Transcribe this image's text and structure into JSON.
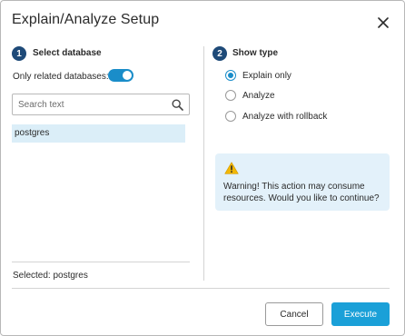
{
  "dialog": {
    "title": "Explain/Analyze Setup",
    "close_icon": "close-icon"
  },
  "step1": {
    "number": "1",
    "title": "Select database",
    "toggle_label": "Only related databases:",
    "toggle_on": true,
    "search": {
      "placeholder": "Search text",
      "value": "",
      "icon": "search-icon"
    },
    "databases": [
      "postgres"
    ],
    "selected_text": "Selected: postgres"
  },
  "step2": {
    "number": "2",
    "title": "Show type",
    "options": [
      {
        "label": "Explain only",
        "checked": true
      },
      {
        "label": "Analyze",
        "checked": false
      },
      {
        "label": "Analyze with rollback",
        "checked": false
      }
    ],
    "warning": {
      "icon": "warning-icon",
      "text": "Warning! This action may consume resources. Would you like to continue?"
    }
  },
  "footer": {
    "cancel_label": "Cancel",
    "execute_label": "Execute"
  },
  "colors": {
    "accent": "#1a8dc9",
    "execute_button": "#1aa0d8",
    "step_badge": "#1e4a78",
    "selected_row": "#dbeef8",
    "warning_bg": "#e3f1fa",
    "warning_icon": "#f2b705"
  }
}
